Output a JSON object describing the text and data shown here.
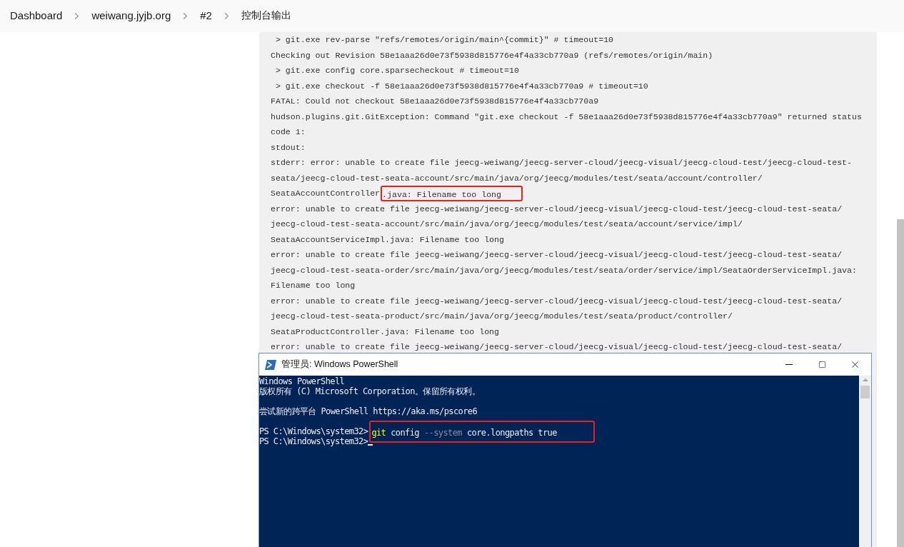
{
  "breadcrumb": [
    "Dashboard",
    "weiwang.jyjb.org",
    "#2",
    "控制台输出"
  ],
  "console_log": {
    "lines": [
      {
        "text": " > git.exe rev-parse \"refs/remotes/origin/main^{commit}\" # timeout=10"
      },
      {
        "text": "Checking out Revision 58e1aaa26d0e73f5938d815776e4f4a33cb770a9 (refs/remotes/origin/main)"
      },
      {
        "text": " > git.exe config core.sparsecheckout # timeout=10"
      },
      {
        "text": " > git.exe checkout -f 58e1aaa26d0e73f5938d815776e4f4a33cb770a9 # timeout=10"
      },
      {
        "text": "FATAL: Could not checkout 58e1aaa26d0e73f5938d815776e4f4a33cb770a9"
      },
      {
        "text": "hudson.plugins.git.GitException: Command \"git.exe checkout -f 58e1aaa26d0e73f5938d815776e4f4a33cb770a9\" returned status"
      },
      {
        "text": "code 1:"
      },
      {
        "text": "stdout:"
      },
      {
        "text": "stderr: error: unable to create file jeecg-weiwang/jeecg-server-cloud/jeecg-visual/jeecg-cloud-test/jeecg-cloud-test-"
      },
      {
        "text": "seata/jeecg-cloud-test-seata-account/src/main/java/org/jeecg/modules/test/seata/account/controller/"
      },
      {
        "text": "SeataAccountController",
        "highlighted_text": ".java: Filename too long"
      },
      {
        "text": "error: unable to create file jeecg-weiwang/jeecg-server-cloud/jeecg-visual/jeecg-cloud-test/jeecg-cloud-test-seata/"
      },
      {
        "text": "jeecg-cloud-test-seata-account/src/main/java/org/jeecg/modules/test/seata/account/service/impl/"
      },
      {
        "text": "SeataAccountServiceImpl.java: Filename too long"
      },
      {
        "text": "error: unable to create file jeecg-weiwang/jeecg-server-cloud/jeecg-visual/jeecg-cloud-test/jeecg-cloud-test-seata/"
      },
      {
        "text": "jeecg-cloud-test-seata-order/src/main/java/org/jeecg/modules/test/seata/order/service/impl/SeataOrderServiceImpl.java:"
      },
      {
        "text": "Filename too long"
      },
      {
        "text": "error: unable to create file jeecg-weiwang/jeecg-server-cloud/jeecg-visual/jeecg-cloud-test/jeecg-cloud-test-seata/"
      },
      {
        "text": "jeecg-cloud-test-seata-product/src/main/java/org/jeecg/modules/test/seata/product/controller/"
      },
      {
        "text": "SeataProductController.java: Filename too long"
      },
      {
        "text": "error: unable to create file jeecg-weiwang/jeecg-server-cloud/jeecg-visual/jeecg-cloud-test/jeecg-cloud-test-seata/"
      }
    ]
  },
  "powershell": {
    "title": "管理员: Windows PowerShell",
    "lines": [
      {
        "kind": "output",
        "text": "Windows PowerShell"
      },
      {
        "kind": "output",
        "text": "版权所有 (C) Microsoft Corporation。保留所有权利。"
      },
      {
        "kind": "blank"
      },
      {
        "kind": "output",
        "text": "尝试新的跨平台 PowerShell https://aka.ms/pscore6"
      },
      {
        "kind": "blank"
      },
      {
        "kind": "command",
        "prompt": "PS C:\\Windows\\system32>",
        "highlighted_tokens": [
          {
            "kind": "command",
            "text": "git"
          },
          {
            "kind": "argument",
            "text": "config"
          },
          {
            "kind": "parameter",
            "text": "--system"
          },
          {
            "kind": "argument",
            "text": "core.longpaths true"
          }
        ]
      },
      {
        "kind": "command",
        "prompt": "PS C:\\Windows\\system32>",
        "cursor": true
      }
    ]
  }
}
